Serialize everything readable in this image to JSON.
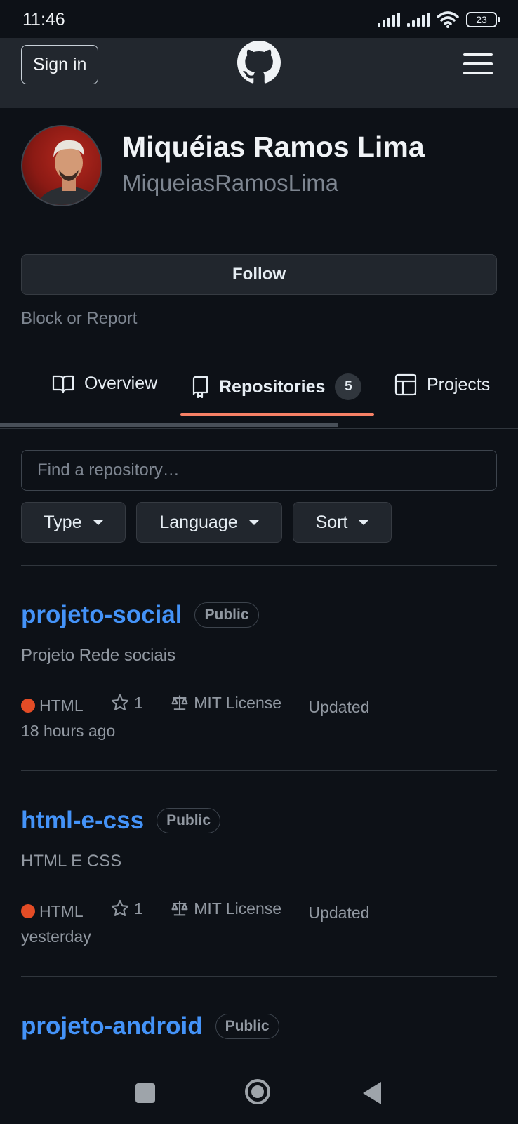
{
  "status_bar": {
    "time": "11:46",
    "battery": "23"
  },
  "header": {
    "sign_in_label": "Sign in"
  },
  "profile": {
    "name": "Miquéias Ramos Lima",
    "login": "MiqueiasRamosLima",
    "follow_label": "Follow",
    "block_report_label": "Block or Report"
  },
  "tabs": [
    {
      "label": "Overview"
    },
    {
      "label": "Repositories",
      "count": "5"
    },
    {
      "label": "Projects"
    }
  ],
  "filters": {
    "search_placeholder": "Find a repository…",
    "type_label": "Type",
    "language_label": "Language",
    "sort_label": "Sort"
  },
  "repos": [
    {
      "name": "projeto-social",
      "visibility": "Public",
      "description": "Projeto Rede sociais",
      "language": "HTML",
      "language_color": "#e34c26",
      "stars": "1",
      "license": "MIT License",
      "updated_prefix": "Updated",
      "updated_time": "18 hours ago"
    },
    {
      "name": "html-e-css",
      "visibility": "Public",
      "description": "HTML E CSS",
      "language": "HTML",
      "language_color": "#e34c26",
      "stars": "1",
      "license": "MIT License",
      "updated_prefix": "Updated",
      "updated_time": "yesterday"
    },
    {
      "name": "projeto-android",
      "visibility": "Public"
    }
  ],
  "colors": {
    "background": "#0d1117",
    "link": "#4493f8",
    "tab_underline": "#f78166"
  }
}
